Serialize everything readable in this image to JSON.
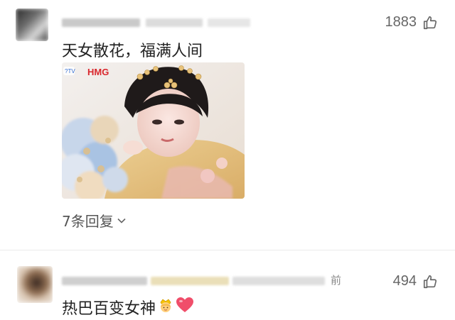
{
  "comments": [
    {
      "likes": "1883",
      "text": "天女散花，福满人间",
      "replies_label": "7条回复",
      "image": {
        "brand": "HMG",
        "tag": "?TV"
      }
    },
    {
      "likes": "494",
      "text": "热巴百变女神",
      "time_suffix": "前",
      "emojis": [
        "crown-princess-emoji",
        "heart-emoji"
      ]
    }
  ],
  "colors": {
    "heart": "#f04e6a",
    "icon_gray": "#666666",
    "divider": "#ececec"
  }
}
